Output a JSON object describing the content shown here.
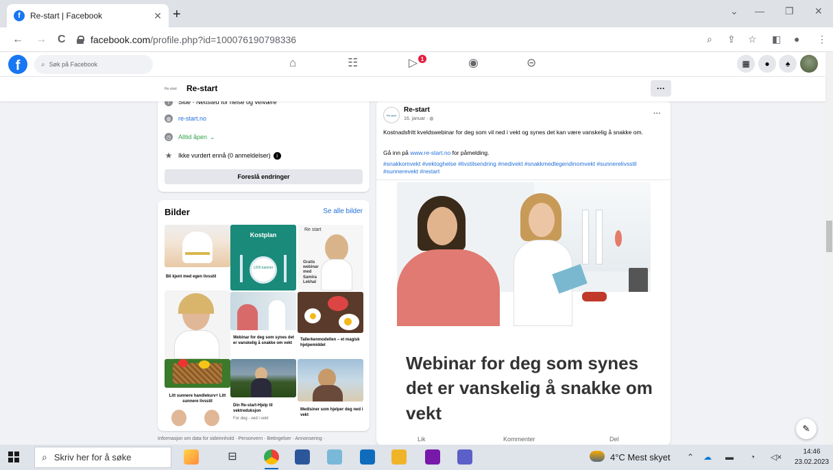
{
  "browser": {
    "tab_title": "Re-start | Facebook",
    "tab_close": "✕",
    "new_tab": "+",
    "window_controls": [
      "⌄",
      "—",
      "❐",
      "✕"
    ],
    "url_host": "facebook.com",
    "url_path": "/profile.php?id=100076190798336",
    "back": "←",
    "forward": "→",
    "reload": "C"
  },
  "facebook": {
    "search_placeholder": "Søk på Facebook",
    "video_notifications": "1",
    "page_name": "Re-start",
    "more": "···"
  },
  "intro": {
    "category_text": "Side · Nettsted for helse og velvære",
    "website": "re-start.no",
    "hours": "Alltid åpen",
    "hours_chevron": "⌄",
    "rating": "Ikke vurdert ennå (0 anmeldelser)",
    "suggest_button": "Foreslå endringer"
  },
  "photos": {
    "title": "Bilder",
    "see_all": "Se alle bilder",
    "captions": [
      "Bli kjent med egen livsstil",
      "Webinar for deg som synes det er vanskelig å snakke om vekt",
      "Tallerkenmodellen – et magisk hjelpemiddel",
      "Litt sunnere handlekurv= Litt sunnere livsstil",
      "Din Re-start-Hjelp til vektreduksjon",
      "Medisiner som hjelper deg ned i vekt"
    ],
    "thumb_texts": {
      "kostplan": "Kostplan",
      "kcal": "1200 kalorier",
      "restart_logo": "Re start",
      "gratis": "Gratis webinar med Samira Lekhal",
      "byline": "For deg - ved i vekt"
    }
  },
  "footer": "Informasjon om data for sideinnhold · Personvern · Betingelser · Annonsering ·",
  "post": {
    "author": "Re-start",
    "avatar_text": "Re-start",
    "date": "16. januar · ",
    "text": "Kostnadsfritt kveldswebinar for deg som vil ned i vekt og synes det kan være vanskelig å snakke om.",
    "cta_prefix": "Gå inn på ",
    "cta_link": "www.re-start.no",
    "cta_suffix": " for påmelding.",
    "hashtags": "#snakkomvekt #vektoghelse #livstilsendring #nedivekt #snakkmedlegendinomvekt #sunnerelivsstil #sunnerevekt #restart",
    "headline": "Webinar for deg som synes det er vanskelig å snakke om vekt",
    "actions": [
      "Lik",
      "Kommenter",
      "Del"
    ]
  },
  "taskbar": {
    "search_placeholder": "Skriv her for å søke",
    "weather": "4°C  Mest skyet",
    "time": "14:46",
    "date": "23.02.2023"
  },
  "colors": {
    "fb_blue": "#1877f2",
    "link": "#216fdb",
    "green": "#31a24c"
  }
}
